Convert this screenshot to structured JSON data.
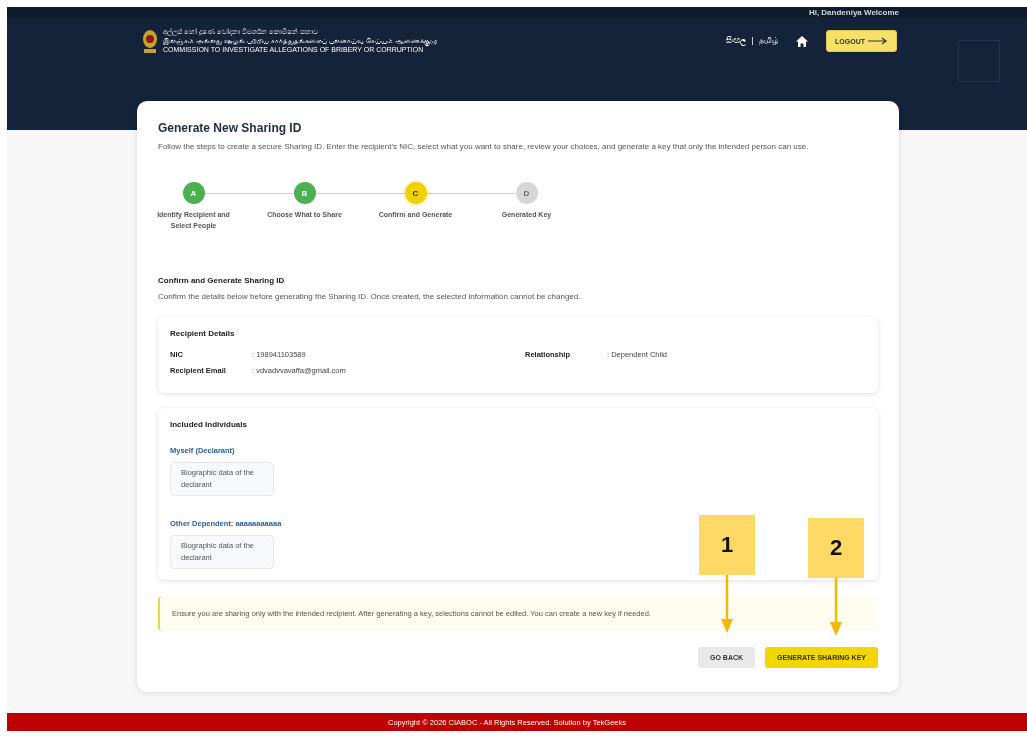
{
  "header": {
    "welcome": "Hi, Dandeniya Welcome",
    "org_name_sinhala": "අල්ලස් හෝ දූෂණ චෝදනා විමර්ශන කොමිෂන් සභාව",
    "org_name_tamil": "இலஞ்சம் அல்லது ஊழல் பற்றிய சார்த்துதல்களைப் புலனாய்வு செய்யும் ஆணைக்குழு",
    "org_name_english": "COMMISSION TO INVESTIGATE ALLEGATIONS OF BRIBERY OR CORRUPTION",
    "languages": [
      {
        "label": "සිංහල"
      },
      {
        "label": "தமிழ்"
      }
    ],
    "logout": "LOGOUT"
  },
  "page": {
    "title": "Generate New Sharing ID",
    "description": "Follow the steps to create a secure Sharing ID. Enter the recipient’s NIC, select what you want to share, review your choices, and generate a key that only the intended person can use."
  },
  "steps": [
    {
      "letter": "A",
      "label": "Identify Recipient and Select People",
      "completed": true,
      "selected": false
    },
    {
      "letter": "B",
      "label": "Choose What to Share",
      "completed": true,
      "selected": false
    },
    {
      "letter": "C",
      "label": "Confirm and Generate",
      "completed": false,
      "selected": true
    },
    {
      "letter": "D",
      "label": "Generated Key",
      "completed": false,
      "selected": false
    }
  ],
  "section": {
    "title": "Confirm and Generate Sharing ID",
    "description": "Confirm the details below before generating the Sharing ID. Once created, the selected information cannot be changed."
  },
  "recipient": {
    "title": "Recipient Details",
    "fields": [
      {
        "label": "NIC",
        "value": ": 198941103589"
      },
      {
        "label": "Relationship",
        "value": ": Dependent Child"
      },
      {
        "label": "Recipient Email",
        "value": ": vdvadvvavaffa@gmail.com"
      }
    ]
  },
  "included": {
    "title": "Included Individuals",
    "groups": [
      {
        "name": "Myself (Declarant)",
        "items": [
          "Biographic data of the declarant"
        ]
      },
      {
        "name": "Other Dependent: aaaaaaaaaaa",
        "items": [
          "Biographic data of the declarant"
        ]
      }
    ]
  },
  "notice": "Ensure you are sharing only with the intended recipient. After generating a key, selections cannot be edited. You can create a new key if needed.",
  "buttons": [
    {
      "label": "GO BACK",
      "kind": "secondary"
    },
    {
      "label": "GENERATE SHARING KEY",
      "kind": "primary"
    }
  ],
  "callouts": [
    {
      "label": "1"
    },
    {
      "label": "2"
    }
  ],
  "footer": "Copyright © 2026 CIABOC - All Rights Reserved. Solution by TekGeeks"
}
